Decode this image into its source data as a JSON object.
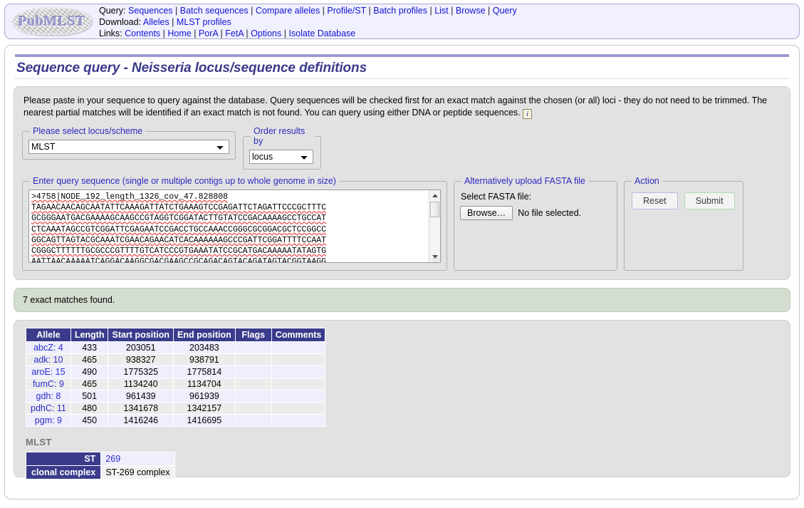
{
  "header": {
    "logo_text": "PubMLST",
    "nav": [
      {
        "label": "Query:",
        "links": [
          "Sequences",
          "Batch sequences",
          "Compare alleles",
          "Profile/ST",
          "Batch profiles",
          "List",
          "Browse",
          "Query"
        ]
      },
      {
        "label": "Download:",
        "links": [
          "Alleles",
          "MLST profiles"
        ]
      },
      {
        "label": "Links:",
        "links": [
          "Contents",
          "Home",
          "PorA",
          "FetA",
          "Options",
          "Isolate Database"
        ]
      }
    ]
  },
  "page": {
    "title": "Sequence query - Neisseria locus/sequence definitions",
    "intro": "Please paste in your sequence to query against the database. Query sequences will be checked first for an exact match against the chosen (or all) loci - they do not need to be trimmed. The nearest partial matches will be identified if an exact match is not found. You can query using either DNA or peptide sequences.",
    "info_icon_glyph": "i"
  },
  "form": {
    "locus_legend": "Please select locus/scheme",
    "locus_value": "MLST",
    "locus_options": [
      "MLST"
    ],
    "order_legend": "Order results by",
    "order_value": "locus",
    "order_options": [
      "locus"
    ],
    "sequence_legend": "Enter query sequence (single or multiple contigs up to whole genome in size)",
    "sequence_value": ">4758|NODE_192_length_1326_cov_47.828808\nTAGAACAACAGCAATATTCAAAGATTATCTGAAAGTCCGAGATTCTAGATTCCCGCTTTC\nGCGGGAATGACGAAAAGCAAGCCGTAGGTCGGATACTTGTATCCGACAAAAGCCTGCCAT\nCTCAAATAGCCGTCGGATTCGAGAATCCGACCTGCCAAACCGGGCGCGGACGCTCCGGCC\nGGCAGTTAGTACGCAAATCGAACAGAACATCACAAAAAAGCCCGATTCGGATTTTCCAAT\nCGGGCTTTTTTGCGCCCGTTTTGTCATCCCGTGAAATATCCGCATGACAAAAATATAGTG\nAATTAACAAAAATCAGGACAAGGCGACGAAGCCGCAGACAGTACAGATAGTACGGTAAGG",
    "fasta_legend": "Alternatively upload FASTA file",
    "fasta_label": "Select FASTA file:",
    "browse_label": "Browse…",
    "no_file_text": "No file selected.",
    "action_legend": "Action",
    "reset_label": "Reset",
    "submit_label": "Submit"
  },
  "status": {
    "message": "7 exact matches found."
  },
  "results": {
    "columns": [
      "Allele",
      "Length",
      "Start position",
      "End position",
      "Flags",
      "Comments"
    ],
    "rows": [
      {
        "allele": "abcZ: 4",
        "length": "433",
        "start": "203051",
        "end": "203483",
        "flags": "",
        "comments": ""
      },
      {
        "allele": "adk: 10",
        "length": "465",
        "start": "938327",
        "end": "938791",
        "flags": "",
        "comments": ""
      },
      {
        "allele": "aroE: 15",
        "length": "490",
        "start": "1775325",
        "end": "1775814",
        "flags": "",
        "comments": ""
      },
      {
        "allele": "fumC: 9",
        "length": "465",
        "start": "1134240",
        "end": "1134704",
        "flags": "",
        "comments": ""
      },
      {
        "allele": "gdh: 8",
        "length": "501",
        "start": "961439",
        "end": "961939",
        "flags": "",
        "comments": ""
      },
      {
        "allele": "pdhC: 11",
        "length": "480",
        "start": "1341678",
        "end": "1342157",
        "flags": "",
        "comments": ""
      },
      {
        "allele": "pgm: 9",
        "length": "450",
        "start": "1416246",
        "end": "1416695",
        "flags": "",
        "comments": ""
      }
    ]
  },
  "mlst": {
    "heading": "MLST",
    "rows": [
      {
        "label": "ST",
        "value": "269"
      },
      {
        "label": "clonal complex",
        "value": "ST-269 complex"
      }
    ]
  },
  "colors": {
    "accent_header": "#3b3b8c",
    "link": "#1414d2",
    "title": "#3a3a8c",
    "status_bg": "#d3ddd0",
    "panel_bg": "#e2e2e2"
  }
}
